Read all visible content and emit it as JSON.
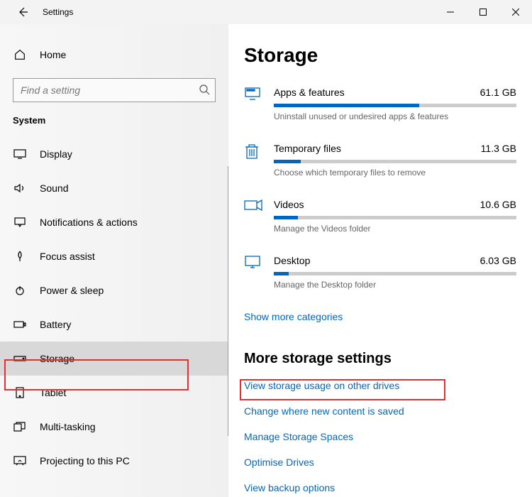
{
  "titlebar": {
    "title": "Settings"
  },
  "sidebar": {
    "home": "Home",
    "search_placeholder": "Find a setting",
    "group": "System",
    "items": [
      {
        "label": "Display"
      },
      {
        "label": "Sound"
      },
      {
        "label": "Notifications & actions"
      },
      {
        "label": "Focus assist"
      },
      {
        "label": "Power & sleep"
      },
      {
        "label": "Battery"
      },
      {
        "label": "Storage"
      },
      {
        "label": "Tablet"
      },
      {
        "label": "Multi-tasking"
      },
      {
        "label": "Projecting to this PC"
      }
    ]
  },
  "content": {
    "title": "Storage",
    "items": [
      {
        "name": "Apps & features",
        "size": "61.1 GB",
        "sub": "Uninstall unused or undesired apps & features",
        "pct": 60
      },
      {
        "name": "Temporary files",
        "size": "11.3 GB",
        "sub": "Choose which temporary files to remove",
        "pct": 11
      },
      {
        "name": "Videos",
        "size": "10.6 GB",
        "sub": "Manage the Videos folder",
        "pct": 10
      },
      {
        "name": "Desktop",
        "size": "6.03 GB",
        "sub": "Manage the Desktop folder",
        "pct": 6
      }
    ],
    "show_more": "Show more categories",
    "more_head": "More storage settings",
    "links": [
      "View storage usage on other drives",
      "Change where new content is saved",
      "Manage Storage Spaces",
      "Optimise Drives",
      "View backup options"
    ]
  }
}
